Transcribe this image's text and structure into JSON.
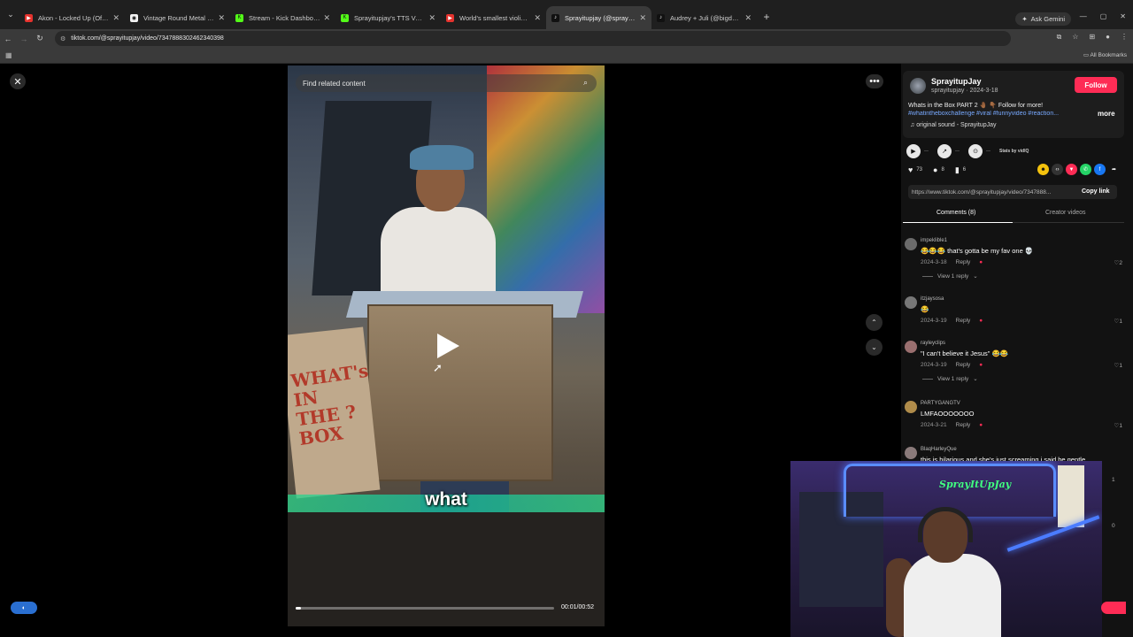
{
  "browser": {
    "tabs": [
      {
        "title": "Akon - Locked Up (Official Mu",
        "fav_color": "#e5322d",
        "fav_glyph": "▶"
      },
      {
        "title": "Vintage Round Metal Polarized",
        "fav_color": "#f2f2f2",
        "fav_glyph": "◉"
      },
      {
        "title": "Stream - Kick Dashboard",
        "fav_color": "#53fc18",
        "fav_glyph": "K"
      },
      {
        "title": "Sprayitupjay's TTS Voice List | K",
        "fav_color": "#53fc18",
        "fav_glyph": "K"
      },
      {
        "title": "World's smallest violin - Spong",
        "fav_color": "#e5322d",
        "fav_glyph": "▶"
      },
      {
        "title": "Sprayitupjay (@sprayitupjay) |",
        "fav_color": "#111111",
        "fav_glyph": "♪"
      },
      {
        "title": "Audrey + Juli (@bigdaddydivas",
        "fav_color": "#111111",
        "fav_glyph": "♪"
      }
    ],
    "active_tab_index": 5,
    "ask_gemini": "Ask Gemini",
    "url": "tiktok.com/@sprayitupjay/video/7347888302462340398",
    "all_bookmarks": "All Bookmarks"
  },
  "video": {
    "search_placeholder": "Find related content",
    "caption": "what",
    "timecode": "00:01/00:52",
    "progress_fraction": 0.02,
    "sign_text": "WHAT's IN THE ? BOX"
  },
  "author": {
    "name": "SprayitupJay",
    "handle_date": "sprayitupjay · 2024-3-18",
    "follow_label": "Follow",
    "description": "Whats in the Box PART 2 🤚🏾 👇🏾 Follow for more!",
    "hashtags": "#whatintheboxchallenge #viral #funnyvideo #reaction...",
    "more_label": "more",
    "sound": "original sound - SprayitupJay"
  },
  "stats": {
    "stats_by": "Stats by vidIQ",
    "likes": "73",
    "comments": "8",
    "saves": "6",
    "link": "https://www.tiktok.com/@sprayitupjay/video/7347888...",
    "copy_label": "Copy link"
  },
  "panel_tabs": {
    "comments": "Comments (8)",
    "creator": "Creator videos"
  },
  "comments": [
    {
      "user": "impeklible1",
      "text": "😂😂😂 that's gotta be my fav one 💀",
      "date": "2024-3-18",
      "reply": "Reply",
      "likes": "2",
      "view": "View 1 reply",
      "avatar": "#6b6b6b"
    },
    {
      "user": "itzjaysosa",
      "text": "😂",
      "date": "2024-3-19",
      "reply": "Reply",
      "likes": "1",
      "view": "",
      "avatar": "#777777"
    },
    {
      "user": "rayleyclips",
      "text": "\"I can't believe it Jesus\" 😂😂",
      "date": "2024-3-19",
      "reply": "Reply",
      "likes": "1",
      "view": "View 1 reply",
      "avatar": "#9a6f6f"
    },
    {
      "user": "PARTYGANGTV",
      "text": "LMFAOOOOOOO",
      "date": "2024-3-21",
      "reply": "Reply",
      "likes": "1",
      "view": "",
      "avatar": "#b08c4a"
    },
    {
      "user": "BlaqHarleyQue",
      "text": "this is hilarious and she's just screaming i said be gentle",
      "date": "",
      "reply": "",
      "likes": "",
      "view": "",
      "avatar": "#8a7a7a"
    }
  ],
  "side_likes": [
    "1",
    "0"
  ],
  "webcam": {
    "logo": "SprayItUpJay"
  }
}
